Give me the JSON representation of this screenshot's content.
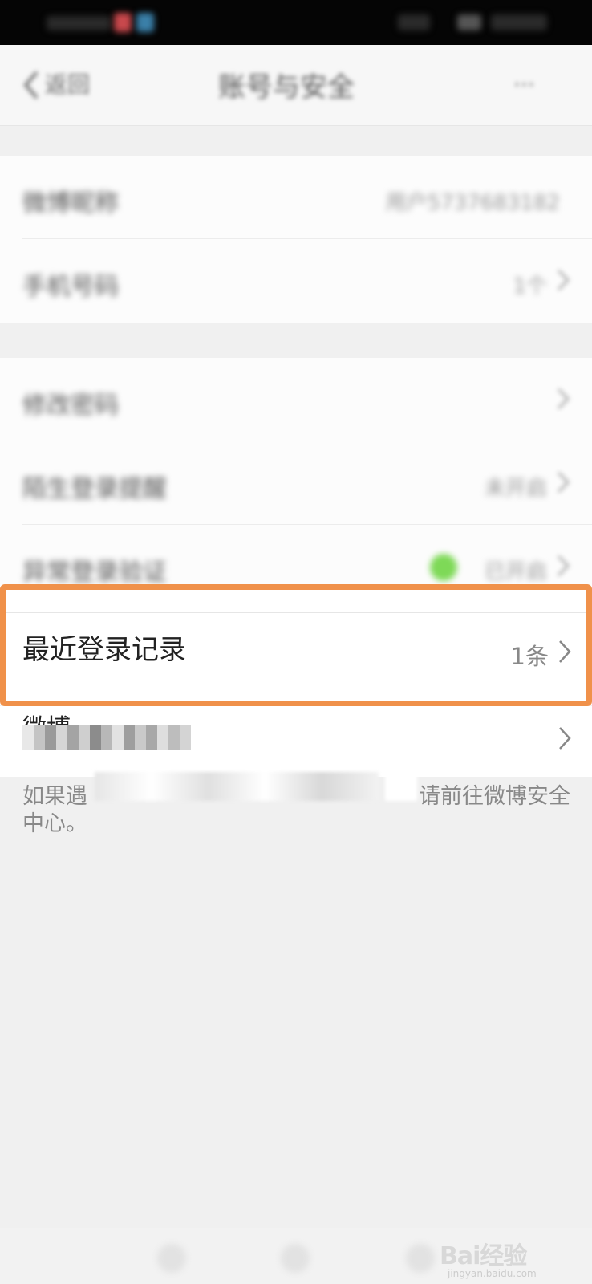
{
  "status_bar": {
    "time": ""
  },
  "nav": {
    "back_label": "返回",
    "title": "账号与安全",
    "more_label": "···"
  },
  "groups": [
    {
      "rows": [
        {
          "label": "微博昵称",
          "value": "用户5737683182"
        },
        {
          "label": "手机号码",
          "value": "1个"
        }
      ]
    },
    {
      "rows": [
        {
          "label": "修改密码",
          "value": ""
        },
        {
          "label": "陌生登录提醒",
          "value": "未开启"
        },
        {
          "label": "异常登录验证",
          "value": "已开启"
        }
      ]
    }
  ],
  "highlight_row": {
    "label": "最近登录记录",
    "count": "1条"
  },
  "weibo_row": {
    "label_partial": "微博"
  },
  "note": {
    "text": "如果遇到账号被盗、忘记密码等问题，请前往微博安全中心。",
    "visible_text": "如果遇",
    "visible_text_2": "请前往微博安全",
    "visible_text_3": "中心。"
  },
  "watermark": {
    "main": "Bai经验",
    "sub": "jingyan.baidu.com"
  },
  "colors": {
    "highlight_border": "#f0914a",
    "toggle_on": "#7ed957"
  }
}
